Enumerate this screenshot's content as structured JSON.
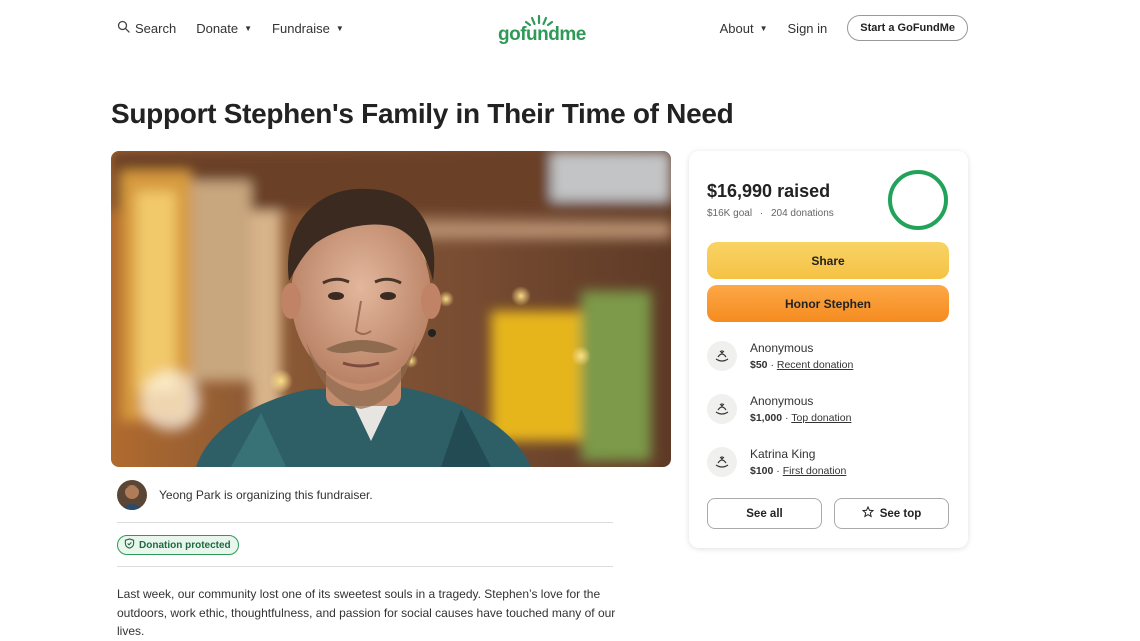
{
  "header": {
    "search_label": "Search",
    "donate_label": "Donate",
    "fundraise_label": "Fundraise",
    "logo_text": "gofundme",
    "about_label": "About",
    "signin_label": "Sign in",
    "start_label": "Start a GoFundMe",
    "icons": {
      "search": "search-icon",
      "caret": "chevron-down-icon"
    }
  },
  "title": "Support Stephen's Family in Their Time of Need",
  "organizer": {
    "text": "Yeong Park is organizing this fundraiser."
  },
  "badge": {
    "label": "Donation protected",
    "icon": "shield-check-icon"
  },
  "story": "Last week, our community lost one of its sweetest souls in a tragedy. Stephen’s love for the outdoors, work ethic, thoughtfulness, and passion for social causes have touched many of our lives.",
  "card": {
    "raised": "$16,990 raised",
    "goal": "$16K goal",
    "separator": "·",
    "donations_count": "204 donations",
    "progress_fraction": 1.0,
    "share_label": "Share",
    "honor_label": "Honor Stephen",
    "donations": [
      {
        "name": "Anonymous",
        "amount": "$50",
        "sep": "·",
        "type": "Recent donation"
      },
      {
        "name": "Anonymous",
        "amount": "$1,000",
        "sep": "·",
        "type": "Top donation"
      },
      {
        "name": "Katrina King",
        "amount": "$100",
        "sep": "·",
        "type": "First donation"
      }
    ],
    "see_all_label": "See all",
    "see_top_label": "See top"
  },
  "colors": {
    "brand_green": "#2f9a57",
    "share_yellow": "#f5c244",
    "honor_orange": "#f58b1f"
  }
}
